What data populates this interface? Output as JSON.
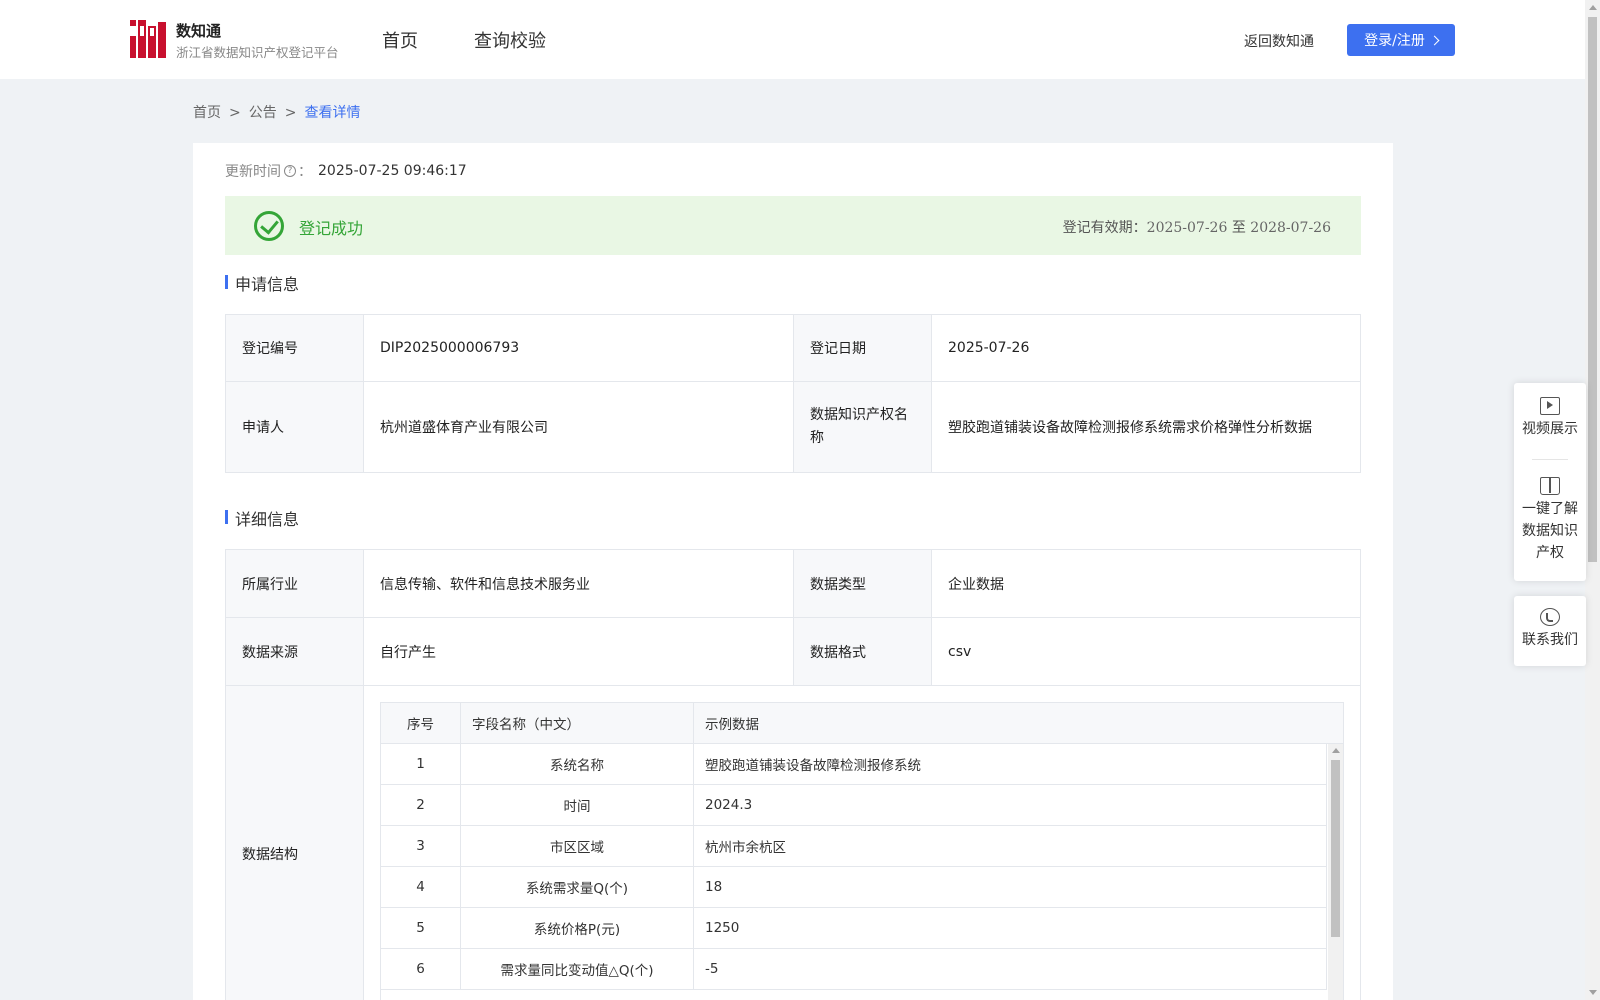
{
  "header": {
    "brand_name": "数知通",
    "brand_sub": "浙江省数据知识产权登记平台",
    "nav": [
      "首页",
      "查询校验"
    ],
    "back_link": "返回数知通",
    "login_label": "登录/注册"
  },
  "breadcrumb": [
    "首页",
    "公告",
    "查看详情"
  ],
  "breadcrumb_sep": ">",
  "update": {
    "label": "更新时间",
    "icon": "question-circle-icon",
    "colon": "：",
    "value": "2025-07-25 09:46:17"
  },
  "status": {
    "icon": "check-circle-icon",
    "text": "登记成功",
    "valid_label": "登记有效期：",
    "valid_from": "2025-07-26",
    "valid_to_word": "至",
    "valid_to": "2028-07-26"
  },
  "sections": {
    "apply": "申请信息",
    "detail": "详细信息"
  },
  "apply_info": {
    "reg_no_label": "登记编号",
    "reg_no": "DIP2025000006793",
    "reg_date_label": "登记日期",
    "reg_date": "2025-07-26",
    "applicant_label": "申请人",
    "applicant": "杭州道盛体育产业有限公司",
    "ip_name_label": "数据知识产权名称",
    "ip_name": "塑胶跑道铺装设备故障检测报修系统需求价格弹性分析数据"
  },
  "detail_info": {
    "industry_label": "所属行业",
    "industry": "信息传输、软件和信息技术服务业",
    "data_type_label": "数据类型",
    "data_type": "企业数据",
    "source_label": "数据来源",
    "source": "自行产生",
    "format_label": "数据格式",
    "format": "csv",
    "structure_label": "数据结构"
  },
  "structure_table": {
    "headers": [
      "序号",
      "字段名称（中文）",
      "示例数据"
    ],
    "rows": [
      [
        "1",
        "系统名称",
        "塑胶跑道铺装设备故障检测报修系统"
      ],
      [
        "2",
        "时间",
        "2024.3"
      ],
      [
        "3",
        "市区区域",
        "杭州市余杭区"
      ],
      [
        "4",
        "系统需求量Q(个)",
        "18"
      ],
      [
        "5",
        "系统价格P(元)",
        "1250"
      ],
      [
        "6",
        "需求量同比变动值△Q(个)",
        "-5"
      ]
    ]
  },
  "side_panel": {
    "video": "视频展示",
    "learn": "一键了解数据知识产权",
    "contact": "联系我们"
  },
  "colors": {
    "accent": "#3d70f0",
    "success": "#34a537",
    "success_bg": "#e9f7e4",
    "logo_red": "#c8102e"
  }
}
